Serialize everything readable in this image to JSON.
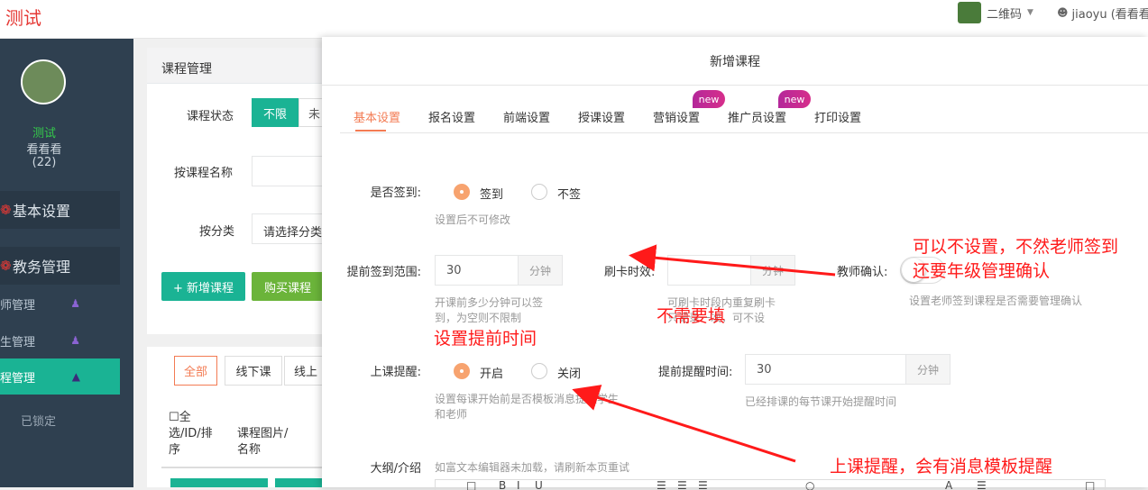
{
  "topbar": {
    "brand": "测试",
    "qr_label": "二维码",
    "user_label": "jiaoyu (看看看",
    "icons": {
      "caret": "caret-down-icon",
      "user": "user-icon"
    }
  },
  "sidebar": {
    "name_line1": "测试",
    "name_line2": "看看看",
    "count": "(22)",
    "sections": [
      {
        "label": "基本设置",
        "icon": "gear-icon"
      },
      {
        "label": "教务管理",
        "icon": "gear-icon"
      }
    ],
    "items": [
      {
        "label": "师管理",
        "icon": "teacher-icon"
      },
      {
        "label": "生管理",
        "icon": "students-icon"
      },
      {
        "label": "程管理",
        "icon": "graduation-cap-icon",
        "active": true
      }
    ],
    "locked_label": "已锁定"
  },
  "course_panel": {
    "title": "课程管理",
    "status_label": "课程状态",
    "status_options": [
      "不限",
      "未"
    ],
    "name_label": "按课程名称",
    "category_label": "按分类",
    "category_placeholder": "请选择分类",
    "add_button": "+ 新增课程",
    "buy_button": "购买课程",
    "filter_tabs": [
      "全部",
      "线下课",
      "线上"
    ],
    "col_check": "全选/ID/排序",
    "col_check_lines": [
      "全",
      "选/ID/排",
      "序"
    ],
    "col_image_lines": [
      "课程图片/",
      "名称"
    ]
  },
  "modal": {
    "title": "新增课程",
    "tabs": [
      {
        "label": "基本设置",
        "active": true
      },
      {
        "label": "报名设置"
      },
      {
        "label": "前端设置"
      },
      {
        "label": "授课设置"
      },
      {
        "label": "营销设置",
        "badge": "new"
      },
      {
        "label": "推广员设置",
        "badge": "new"
      },
      {
        "label": "打印设置"
      }
    ],
    "signin": {
      "label": "是否签到:",
      "options": [
        "签到",
        "不签"
      ],
      "help": "设置后不可修改"
    },
    "advance_range": {
      "label": "提前签到范围:",
      "value": "30",
      "unit": "分钟",
      "help_lines": [
        "开课前多少分钟可以签",
        "到，为空则不限制"
      ]
    },
    "card_period": {
      "label": "刷卡时效:",
      "unit": "分钟",
      "help_lines": [
        "可刷卡时段内重复刷卡",
        "只记录一次，可不设"
      ]
    },
    "teacher_confirm": {
      "label": "教师确认:",
      "help": "设置老师签到课程是否需要管理确认"
    },
    "class_reminder": {
      "label": "上课提醒:",
      "options": [
        "开启",
        "关闭"
      ],
      "help_lines": [
        "设置每课开始前是否模板消息提醒学生",
        "和老师"
      ]
    },
    "reminder_time": {
      "label": "提前提醒时间:",
      "value": "30",
      "unit": "分钟",
      "help": "已经排课的每节课开始提醒时间"
    },
    "outline": {
      "label": "大纲/介绍",
      "help": "如富文本编辑器未加载，请刷新本页重试"
    }
  },
  "annotations": {
    "teacher_note_lines": [
      "可以不设置，不然老师签到",
      "还要年级管理确认"
    ],
    "card_note": "不需要填",
    "advance_note": "设置提前时间",
    "reminder_note": "上课提醒，会有消息模板提醒",
    "color": "#ff1a1a"
  },
  "colors": {
    "primary": "#1ab394",
    "accent": "#f37b53",
    "sidebar": "#2f4050",
    "badge": "#c2298f"
  }
}
